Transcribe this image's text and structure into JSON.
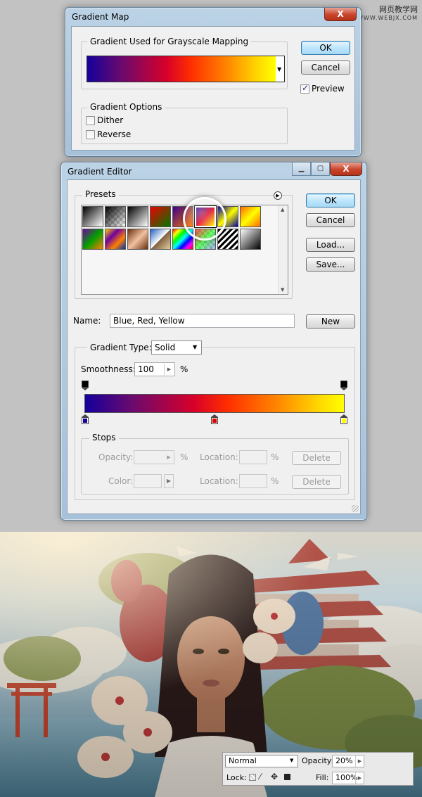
{
  "watermark": {
    "line1": "网页教学网",
    "line2": "WWW.WEBJX.COM"
  },
  "gradient_map": {
    "title": "Gradient Map",
    "close_label": "X",
    "used_group": "Gradient Used for Grayscale Mapping",
    "ok": "OK",
    "cancel": "Cancel",
    "preview": "Preview",
    "options_group": "Gradient Options",
    "dither": "Dither",
    "reverse": "Reverse"
  },
  "gradient_editor": {
    "title": "Gradient Editor",
    "close_label": "X",
    "presets_label": "Presets",
    "ok": "OK",
    "cancel": "Cancel",
    "load": "Load...",
    "save": "Save...",
    "name_label": "Name:",
    "name_value": "Blue, Red, Yellow",
    "new": "New",
    "type_label": "Gradient Type:",
    "type_value": "Solid",
    "smooth_label": "Smoothness:",
    "smooth_value": "100",
    "smooth_unit": "%",
    "stops_group": "Stops",
    "opacity_label": "Opacity:",
    "color_label": "Color:",
    "location_label": "Location:",
    "percent": "%",
    "delete": "Delete"
  },
  "layers_palette": {
    "blend_mode": "Normal",
    "opacity_label": "Opacity:",
    "opacity_value": "20%",
    "lock_label": "Lock:",
    "fill_label": "Fill:",
    "fill_value": "100%"
  },
  "colors": {
    "stop_left": "#14009c",
    "stop_mid": "#e00000",
    "stop_right": "#ffff00"
  }
}
